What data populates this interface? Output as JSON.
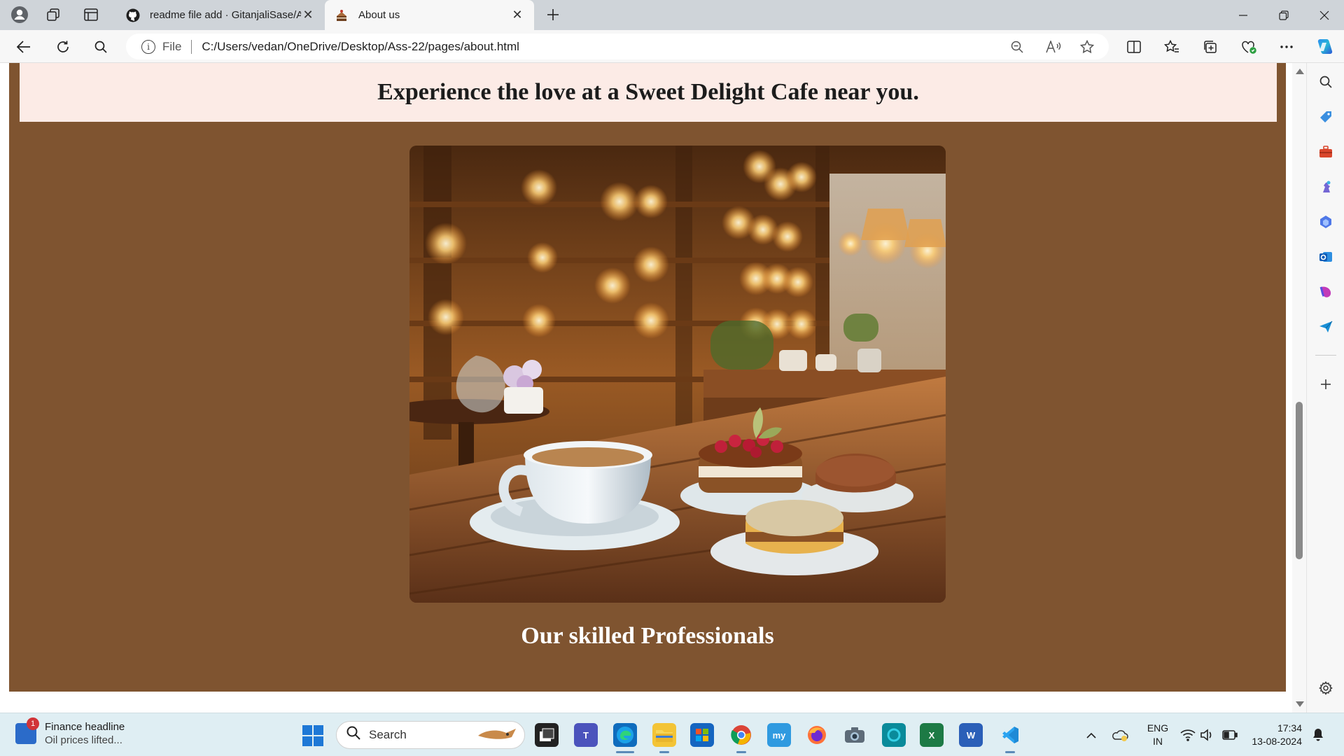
{
  "browser": {
    "tabs": [
      {
        "title": "readme file add · GitanjaliSase/A",
        "favicon": "github-icon",
        "active": false
      },
      {
        "title": "About us",
        "favicon": "cake-icon",
        "active": true
      }
    ],
    "address": {
      "scheme_label": "File",
      "url": "C:/Users/vedan/OneDrive/Desktop/Ass-22/pages/about.html"
    }
  },
  "page": {
    "banner_heading": "Experience the love at a Sweet Delight Cafe near you.",
    "image_alt": "Coffee cup and cakes on a wooden table in a warmly lit cafe",
    "section_heading": "Our skilled Professionals",
    "colors": {
      "page_background": "#7f5430",
      "banner_background": "#fcebe6"
    }
  },
  "taskbar": {
    "widget": {
      "headline": "Finance headline",
      "subtext": "Oil prices lifted...",
      "badge": "1"
    },
    "search_label": "Search",
    "language": {
      "line1": "ENG",
      "line2": "IN"
    },
    "time": "17:34",
    "date": "13-08-2024"
  }
}
